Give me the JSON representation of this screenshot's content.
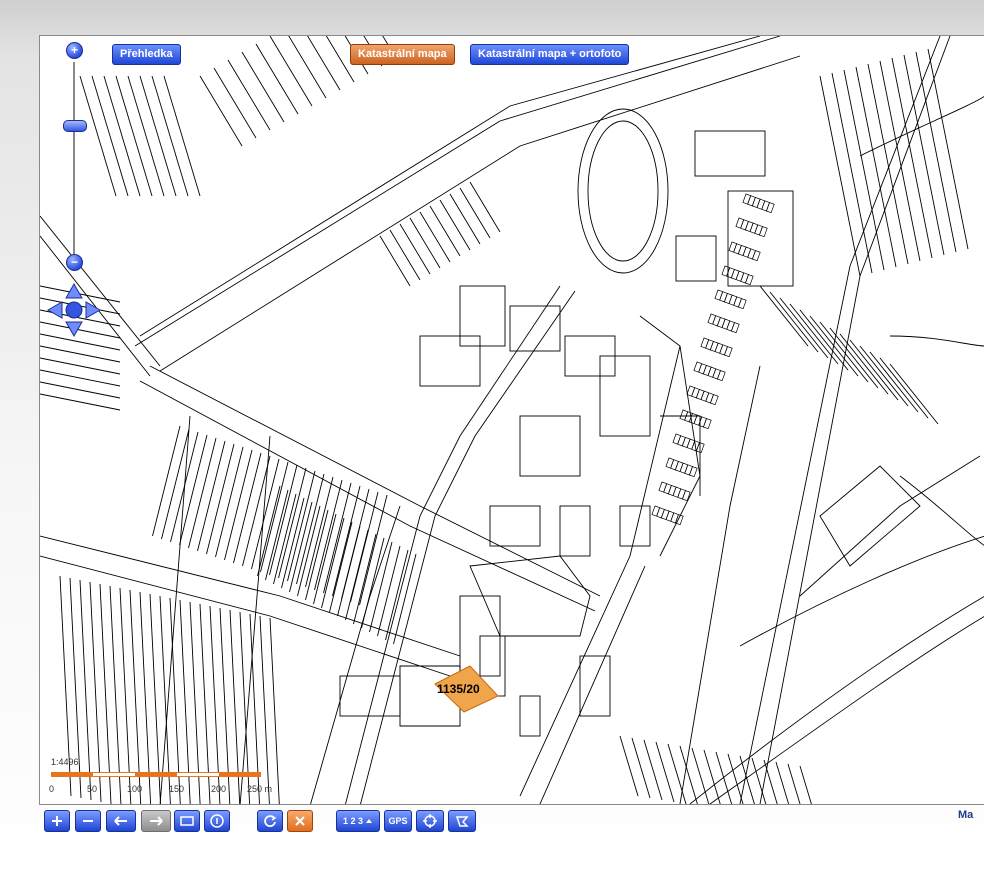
{
  "layer_buttons": {
    "overview": "Přehledka",
    "cadastral": "Katastrální mapa",
    "cadastral_ortho": "Katastrální mapa + ortofoto"
  },
  "zoom": {
    "plus": "+",
    "minus": "−"
  },
  "map": {
    "selected_parcel": "1135/20",
    "highlight_color": "#f0a54a",
    "line_color": "#000000"
  },
  "scale_bar": {
    "ratio": "1:4496",
    "ticks": [
      "0",
      "50",
      "100",
      "150",
      "200",
      "250 m"
    ],
    "colors": [
      "#e8741e",
      "#ffffff"
    ]
  },
  "toolbar": {
    "numbers_label": "1 2 3",
    "gps_label": "GPS",
    "icons": [
      "zoom-in-icon",
      "zoom-out-icon",
      "back-icon",
      "forward-icon",
      "zoom-rectangle-icon",
      "info-icon",
      "refresh-icon",
      "clear-icon",
      "measure-icon",
      "gps-icon",
      "locate-icon",
      "polygon-icon"
    ]
  },
  "brand_text": "Ma"
}
